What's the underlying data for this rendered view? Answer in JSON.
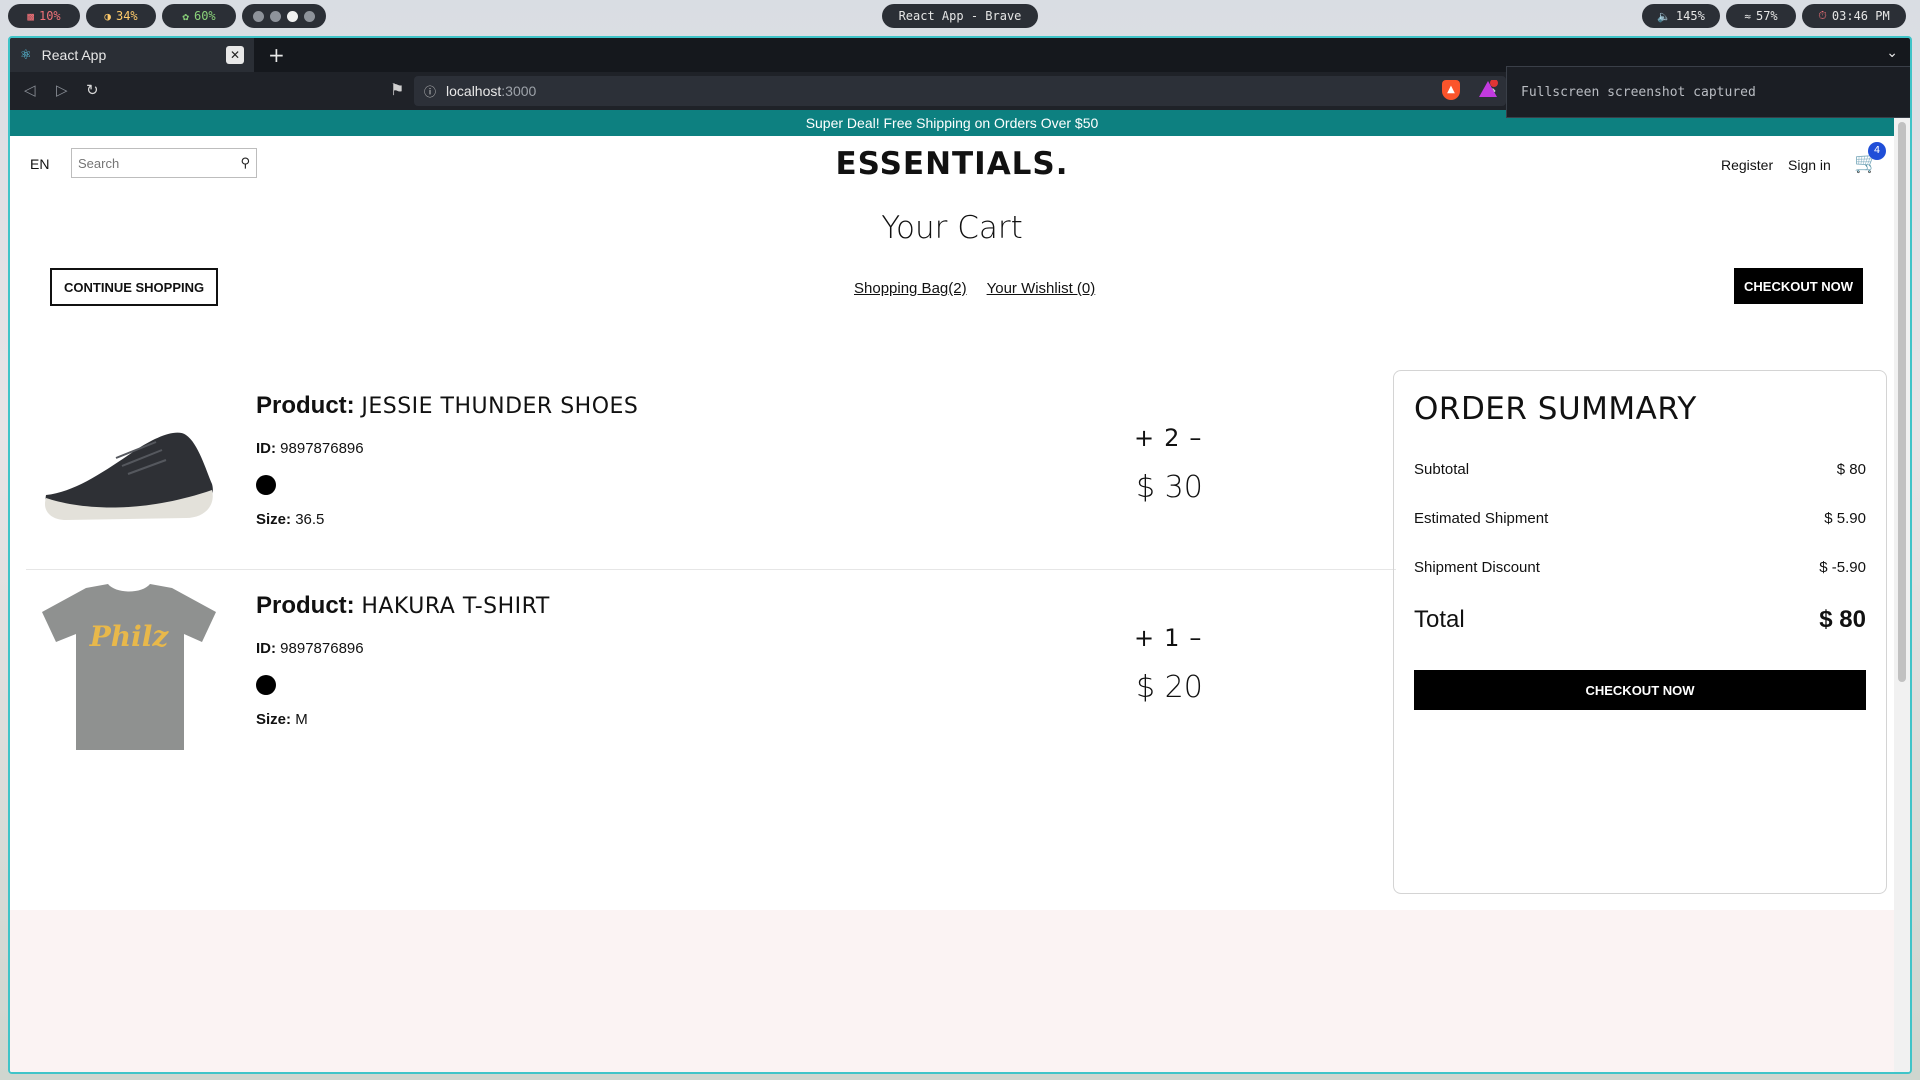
{
  "system": {
    "cpu": "10%",
    "mem": "34%",
    "battery": "60%",
    "window_title": "React App - Brave",
    "volume": "145%",
    "wifi": "57%",
    "clock": "03:46 PM"
  },
  "browser": {
    "tab_title": "React App",
    "url_host": "localhost",
    "url_port": ":3000",
    "notification": "Fullscreen screenshot captured"
  },
  "page": {
    "announcement": "Super Deal! Free Shipping on Orders Over $50",
    "lang": "EN",
    "search_placeholder": "Search",
    "logo": "ESSENTIALS.",
    "register": "Register",
    "signin": "Sign in",
    "cart_count": "4",
    "title": "Your Cart",
    "continue_label": "CONTINUE SHOPPING",
    "bag_link": "Shopping Bag(2)",
    "wishlist_link": "Your Wishlist (0)",
    "checkout_top": "CHECKOUT NOW"
  },
  "products": [
    {
      "product_label": "Product:",
      "name": "JESSIE THUNDER SHOES",
      "id_label": "ID:",
      "id": "9897876896",
      "color": "#000000",
      "size_label": "Size:",
      "size": "36.5",
      "plus": "+",
      "qty": "2",
      "minus": "–",
      "price": "$ 30"
    },
    {
      "product_label": "Product:",
      "name": "HAKURA T-SHIRT",
      "id_label": "ID:",
      "id": "9897876896",
      "color": "#000000",
      "size_label": "Size:",
      "size": "M",
      "plus": "+",
      "qty": "1",
      "minus": "–",
      "price": "$ 20"
    }
  ],
  "summary": {
    "title": "ORDER SUMMARY",
    "subtotal_label": "Subtotal",
    "subtotal": "$ 80",
    "shipment_label": "Estimated Shipment",
    "shipment": "$ 5.90",
    "discount_label": "Shipment Discount",
    "discount": "$ -5.90",
    "total_label": "Total",
    "total": "$ 80",
    "checkout": "CHECKOUT NOW"
  },
  "tshirt_print": "Philz"
}
